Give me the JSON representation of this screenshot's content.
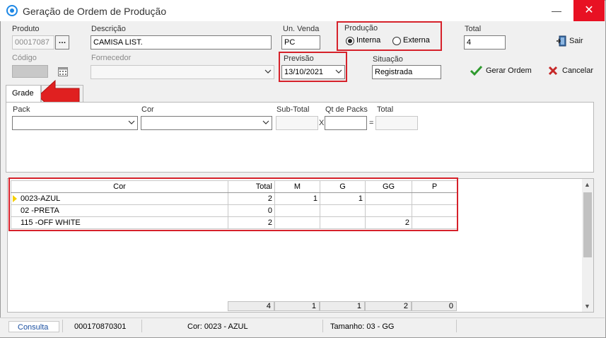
{
  "window": {
    "title": "Geração de Ordem de Produção",
    "minimize": "—",
    "close": "✕"
  },
  "form": {
    "produto": {
      "label": "Produto",
      "value": "00017087"
    },
    "descricao": {
      "label": "Descrição",
      "value": "CAMISA LIST."
    },
    "un_venda": {
      "label": "Un. Venda",
      "value": "PC"
    },
    "producao": {
      "label": "Produção",
      "options": [
        "Interna",
        "Externa"
      ],
      "selected": "Interna"
    },
    "total": {
      "label": "Total",
      "value": "4"
    },
    "codigo": {
      "label": "Código",
      "value": ""
    },
    "fornecedor": {
      "label": "Fornecedor",
      "value": ""
    },
    "previsao": {
      "label": "Previsão",
      "value": "13/10/2021"
    },
    "situacao": {
      "label": "Situação",
      "value": "Registrada"
    }
  },
  "actions": {
    "sair": "Sair",
    "gerar": "Gerar Ordem",
    "cancelar": "Cancelar"
  },
  "tabs": [
    {
      "label": "Grade"
    },
    {
      "label": ""
    }
  ],
  "grade_panel": {
    "pack": {
      "label": "Pack",
      "value": ""
    },
    "cor": {
      "label": "Cor",
      "value": ""
    },
    "subtotal": {
      "label": "Sub-Total",
      "value": ""
    },
    "x": "X",
    "qt_packs": {
      "label": "Qt de Packs",
      "value": ""
    },
    "eq": "=",
    "total": {
      "label": "Total",
      "value": ""
    }
  },
  "grid": {
    "columns": [
      "Cor",
      "Total",
      "M",
      "G",
      "GG",
      "P"
    ],
    "rows": [
      {
        "cor": "0023-AZUL",
        "total": "2",
        "m": "1",
        "g": "1",
        "gg": "",
        "p": ""
      },
      {
        "cor": "02  -PRETA",
        "total": "0",
        "m": "",
        "g": "",
        "gg": "",
        "p": ""
      },
      {
        "cor": "115 -OFF WHITE",
        "total": "2",
        "m": "",
        "g": "",
        "gg": "2",
        "p": ""
      }
    ],
    "totals": {
      "total": "4",
      "m": "1",
      "g": "1",
      "gg": "2",
      "p": "0"
    }
  },
  "status_bar": {
    "mode": "Consulta",
    "code": "000170870301",
    "cor": "Cor: 0023 - AZUL",
    "tamanho": "Tamanho: 03 - GG"
  },
  "colors": {
    "highlight_red": "#d6212a",
    "selected_row_marker": "#f5d000",
    "close_red": "#e81123"
  }
}
